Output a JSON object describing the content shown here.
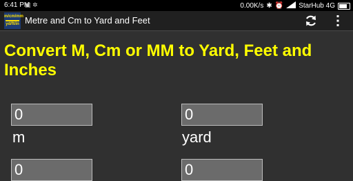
{
  "status_bar": {
    "time": "6:41 PM",
    "notifications": "▣ ✲",
    "data_speed": "0.00K/s",
    "bluetooth": "✱",
    "alarm": "⏰",
    "carrier": "StarHub 4G"
  },
  "app_bar": {
    "icon_text_top": "m/cm/mm",
    "icon_text_bottom": "yd/ft/in",
    "title": "Metre and Cm to Yard and Feet",
    "refresh_icon": "refresh-icon",
    "menu_icon": "overflow-menu-icon"
  },
  "heading": "Convert M, Cm or MM to Yard, Feet and Inches",
  "fields": [
    {
      "value": "0",
      "unit": "m"
    },
    {
      "value": "0",
      "unit": "yard"
    },
    {
      "value": "0",
      "unit": ""
    },
    {
      "value": "0",
      "unit": ""
    }
  ],
  "colors": {
    "heading": "#ffff00",
    "background": "#303030",
    "field_background": "#6b6b6b"
  }
}
